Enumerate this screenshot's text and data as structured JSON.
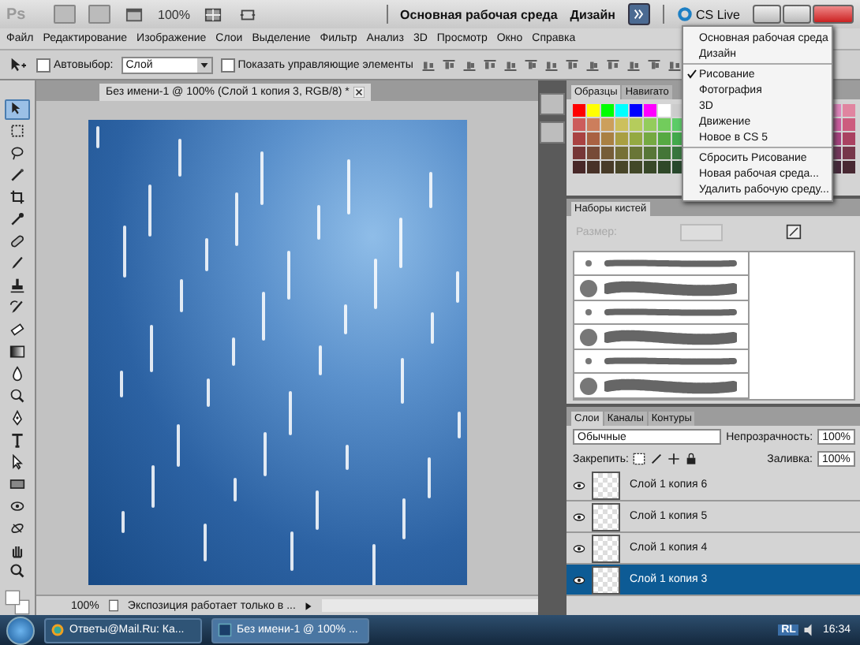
{
  "app_bar": {
    "logo": "Ps",
    "zoom": "100%",
    "workspaces": [
      {
        "label": "Основная рабочая среда",
        "selected": false
      },
      {
        "label": "Дизайн",
        "selected": false
      }
    ],
    "more_open": true,
    "cs_live": "CS Live"
  },
  "menu": [
    "Файл",
    "Редактирование",
    "Изображение",
    "Слои",
    "Выделение",
    "Фильтр",
    "Анализ",
    "3D",
    "Просмотр",
    "Окно",
    "Справка"
  ],
  "options": {
    "autoselect": {
      "label": "Автовыбор:",
      "checked": false
    },
    "target": "Слой",
    "show_controls": {
      "label": "Показать управляющие элементы",
      "checked": false
    }
  },
  "tools": [
    {
      "kind": "move",
      "selected": true
    },
    {
      "kind": "marquee",
      "selected": false
    },
    {
      "kind": "lasso",
      "selected": false
    },
    {
      "kind": "wand",
      "selected": false
    },
    {
      "kind": "crop",
      "selected": false
    },
    {
      "kind": "eyedropper",
      "selected": false
    },
    {
      "kind": "heal",
      "selected": false
    },
    {
      "kind": "brush",
      "selected": false
    },
    {
      "kind": "stamp",
      "selected": false
    },
    {
      "kind": "history",
      "selected": false
    },
    {
      "kind": "eraser",
      "selected": false
    },
    {
      "kind": "gradient",
      "selected": false
    },
    {
      "kind": "blur",
      "selected": false
    },
    {
      "kind": "dodge",
      "selected": false
    },
    {
      "kind": "pen",
      "selected": false
    },
    {
      "kind": "type",
      "selected": false
    },
    {
      "kind": "path",
      "selected": false
    },
    {
      "kind": "shape",
      "selected": false
    },
    {
      "kind": "rotate3d",
      "selected": false
    },
    {
      "kind": "orbit3d",
      "selected": false
    },
    {
      "kind": "hand",
      "selected": false
    },
    {
      "kind": "zoom",
      "selected": false
    }
  ],
  "document": {
    "tab": "Без имени-1 @ 100% (Слой 1 копия 3, RGB/8) *",
    "status_zoom": "100%",
    "status_text": "Экспозиция работает только в ..."
  },
  "workspace_menu": [
    {
      "items": [
        {
          "label": "Основная рабочая среда",
          "checked": false
        },
        {
          "label": "Дизайн",
          "checked": false
        }
      ]
    },
    {
      "items": [
        {
          "label": "Рисование",
          "checked": true
        },
        {
          "label": "Фотография",
          "checked": false
        },
        {
          "label": "3D",
          "checked": false
        },
        {
          "label": "Движение",
          "checked": false
        },
        {
          "label": "Новое в CS 5",
          "checked": false
        }
      ]
    },
    {
      "items": [
        {
          "label": "Сбросить Рисование",
          "checked": false
        },
        {
          "label": "Новая рабочая среда...",
          "checked": false
        },
        {
          "label": "Удалить рабочую среду...",
          "checked": false
        }
      ]
    }
  ],
  "swatches_panel": {
    "tabs": [
      {
        "label": "Образцы",
        "selected": true
      },
      {
        "label": "Навигато",
        "selected": false
      }
    ]
  },
  "brushes_panel": {
    "tabs": [
      {
        "label": "Наборы кистей",
        "selected": true
      }
    ],
    "size_label": "Размер:"
  },
  "layers_panel": {
    "tabs": [
      {
        "label": "Слои",
        "selected": true
      },
      {
        "label": "Каналы",
        "selected": false
      },
      {
        "label": "Контуры",
        "selected": false
      }
    ],
    "blend_mode": "Обычные",
    "opacity_label": "Непрозрачность:",
    "opacity": "100%",
    "lock_label": "Закрепить:",
    "fill_label": "Заливка:",
    "fill": "100%",
    "layers": [
      {
        "name": "Слой 1 копия 6",
        "visible": true,
        "selected": false
      },
      {
        "name": "Слой 1 копия 5",
        "visible": true,
        "selected": false
      },
      {
        "name": "Слой 1 копия 4",
        "visible": true,
        "selected": false
      },
      {
        "name": "Слой 1 копия 3",
        "visible": true,
        "selected": true
      }
    ]
  },
  "taskbar": {
    "tasks": [
      {
        "label": "Ответы@Mail.Ru: Ка...",
        "kind": "browser",
        "selected": false
      },
      {
        "label": "Без имени-1 @ 100% ...",
        "kind": "photoshop",
        "selected": true
      }
    ],
    "tray_label": "RL",
    "clock": "16:34"
  }
}
